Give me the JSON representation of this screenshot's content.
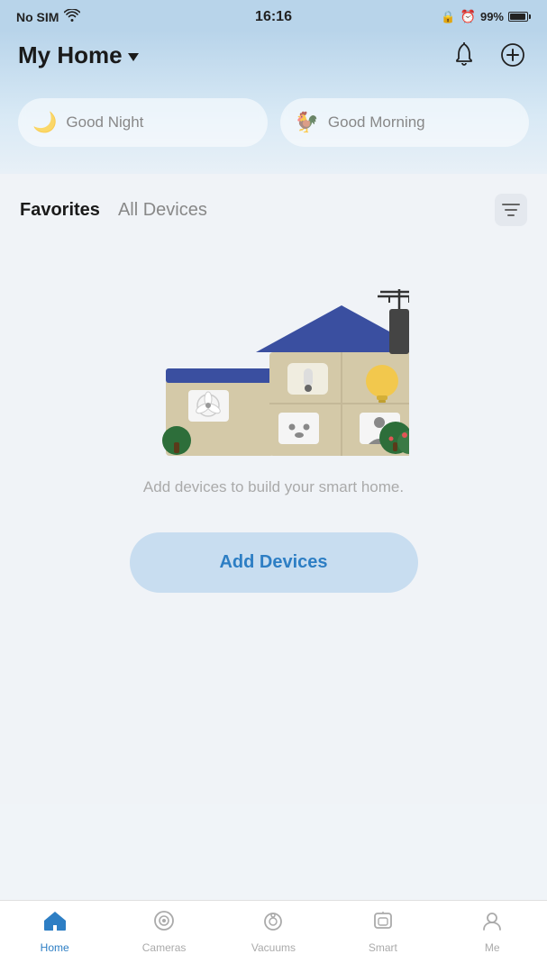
{
  "status": {
    "carrier": "No SIM",
    "time": "16:16",
    "battery_pct": "99%"
  },
  "header": {
    "home_title": "My Home",
    "bell_icon": "bell-icon",
    "add_icon": "add-circle-icon"
  },
  "scenes": [
    {
      "id": "good-night",
      "icon": "🌙",
      "label": "Good Night"
    },
    {
      "id": "good-morning",
      "icon": "🐓",
      "label": "Good Morning"
    }
  ],
  "tabs": {
    "favorites_label": "Favorites",
    "all_devices_label": "All Devices"
  },
  "empty_state": {
    "message": "Add devices to build your smart home."
  },
  "add_devices_btn": "Add Devices",
  "bottom_nav": {
    "items": [
      {
        "id": "home",
        "label": "Home",
        "active": true
      },
      {
        "id": "cameras",
        "label": "Cameras",
        "active": false
      },
      {
        "id": "vacuums",
        "label": "Vacuums",
        "active": false
      },
      {
        "id": "smart",
        "label": "Smart",
        "active": false
      },
      {
        "id": "me",
        "label": "Me",
        "active": false
      }
    ]
  }
}
